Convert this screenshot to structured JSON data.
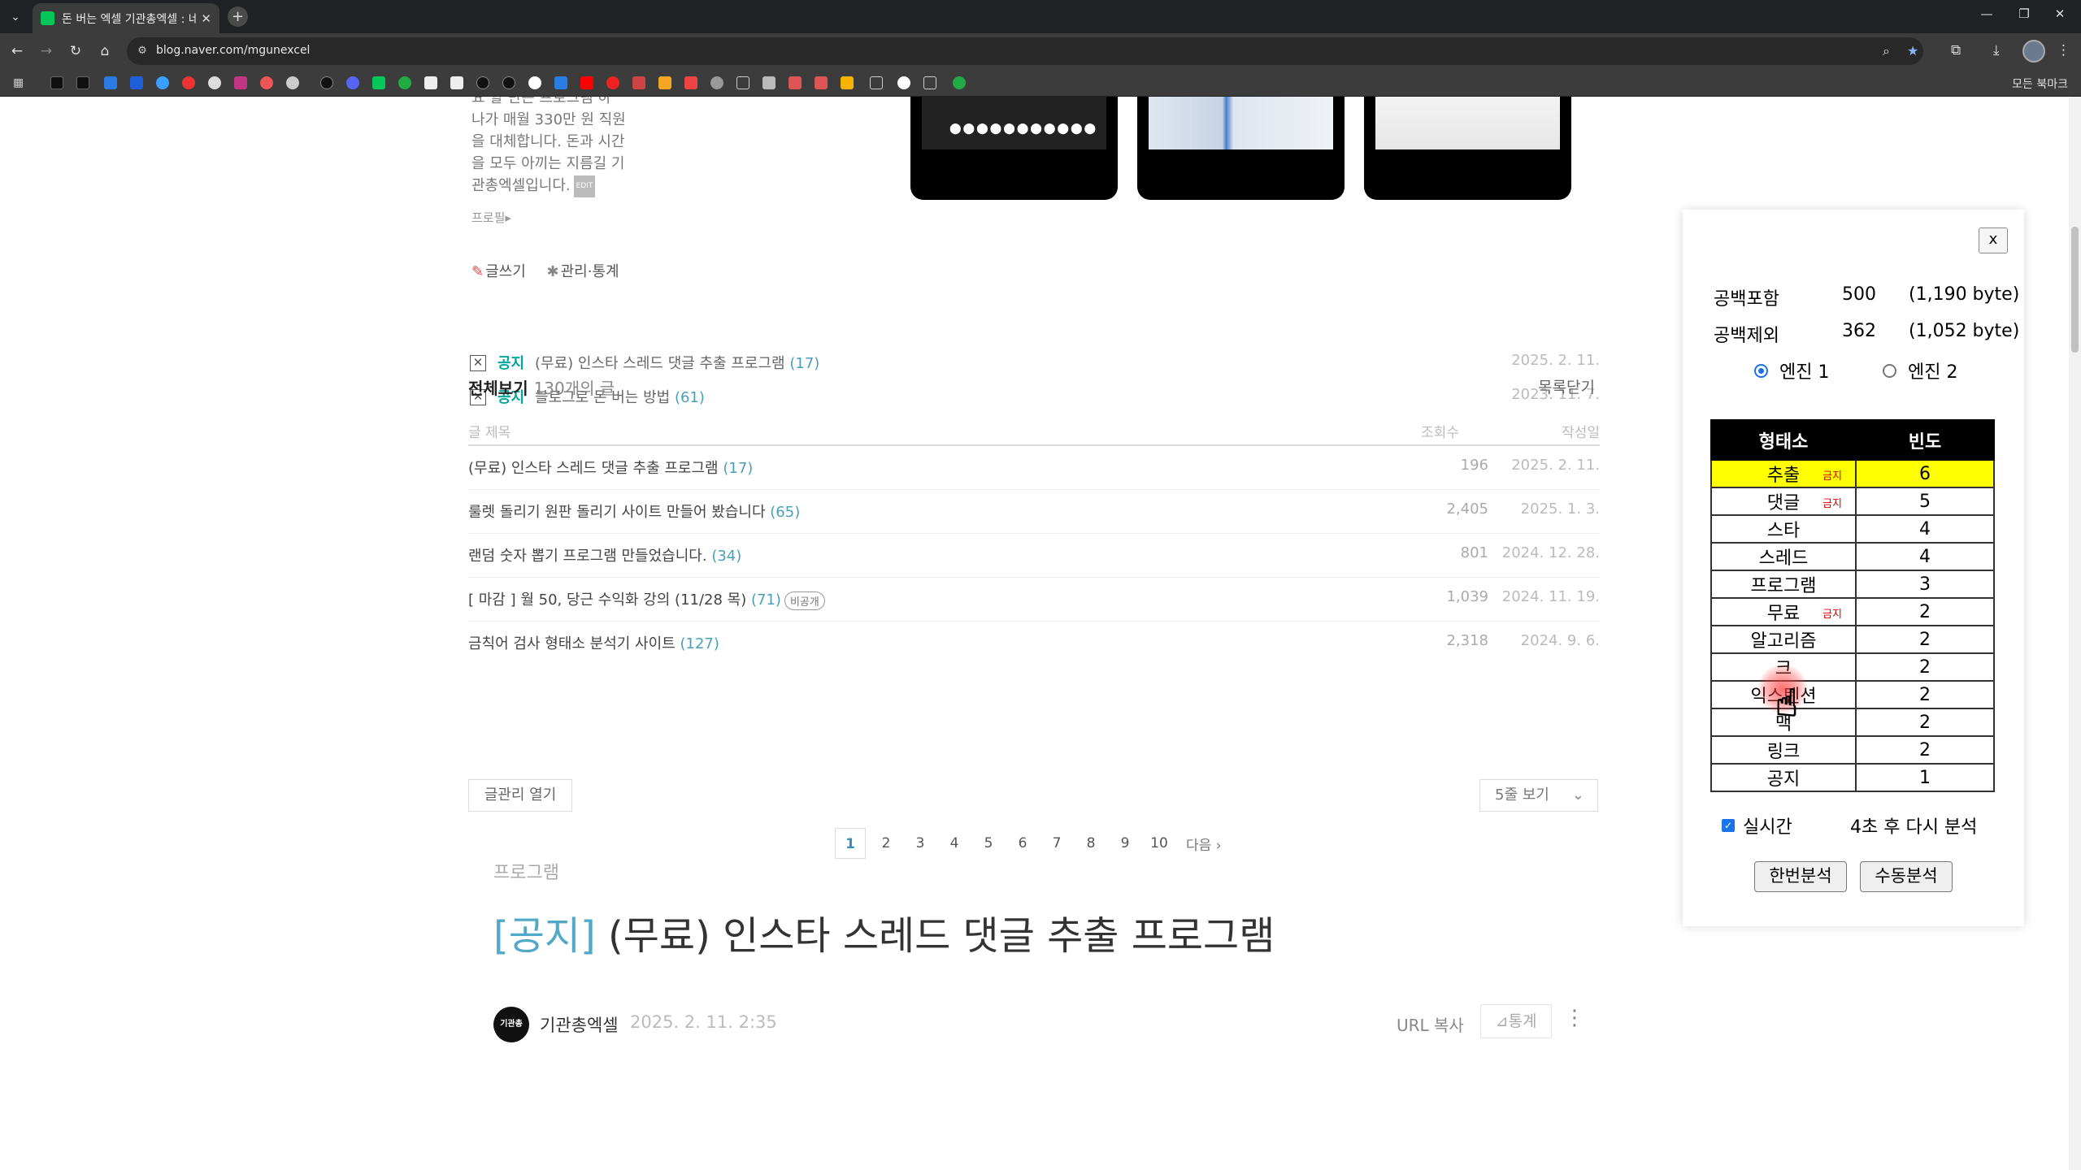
{
  "browser": {
    "tab_title": "돈 버는 엑셀 기관총엑셀 : 네이",
    "url": "blog.naver.com/mgunexcel",
    "all_bookmarks": "모든 북마크"
  },
  "profile": {
    "desc_lines": [
      "요  할 만든 프로그램 하",
      "나가 매월 330만 원 직원",
      "을 대체합니다.   돈과 시간",
      "을 모두 아끼는 지름길 기",
      "관총엑셀입니다."
    ],
    "edit_badge": "EDIT",
    "profile_link": "프로필▸",
    "write": "글쓰기",
    "manage": "관리·통계"
  },
  "notices": [
    {
      "tag": "공지",
      "title": "(무료) 인스타 스레드 댓글 추출 프로그램",
      "count": "(17)",
      "date": "2025. 2. 11."
    },
    {
      "tag": "공지",
      "title": "블로그로 돈 버는 방법",
      "count": "(61)",
      "date": "2023. 11. 7."
    }
  ],
  "post_list": {
    "heading": "전체보기",
    "total": "130개의 글",
    "close": "목록닫기",
    "col_title": "글 제목",
    "col_views": "조회수",
    "col_date": "작성일",
    "rows": [
      {
        "title": "(무료) 인스타 스레드 댓글 추출 프로그램",
        "count": "(17)",
        "views": "196",
        "date": "2025. 2. 11."
      },
      {
        "title": "룰렛 돌리기 원판 돌리기 사이트 만들어 봤습니다",
        "count": "(65)",
        "views": "2,405",
        "date": "2025. 1. 3."
      },
      {
        "title": "랜덤 숫자 뽑기 프로그램 만들었습니다.",
        "count": "(34)",
        "views": "801",
        "date": "2024. 12. 28."
      },
      {
        "title": "[ 마감 ] 월 50, 당근 수익화 강의 (11/28 목)",
        "count": "(71)",
        "badge": "비공개",
        "views": "1,039",
        "date": "2024. 11. 19."
      },
      {
        "title": "금칙어 검사 형태소 분석기 사이트",
        "count": "(127)",
        "views": "2,318",
        "date": "2024. 9. 6."
      }
    ],
    "manage_btn": "글관리 열기",
    "rows_select": "5줄 보기",
    "pages": [
      "1",
      "2",
      "3",
      "4",
      "5",
      "6",
      "7",
      "8",
      "9",
      "10"
    ],
    "next": "다음"
  },
  "post": {
    "category": "프로그램",
    "bracket": "[공지]",
    "title": "(무료) 인스타 스레드 댓글 추출 프로그램",
    "author": "기관총엑셀",
    "avatar_text": "기관총",
    "date": "2025. 2. 11. 2:35",
    "url_copy": "URL 복사",
    "stats": "통계"
  },
  "analyzer": {
    "close": "x",
    "with_space_label": "공백포함",
    "with_space_count": "500",
    "with_space_bytes": "(1,190 byte)",
    "no_space_label": "공백제외",
    "no_space_count": "362",
    "no_space_bytes": "(1,052 byte)",
    "engine1": "엔진 1",
    "engine2": "엔진 2",
    "col_morpheme": "형태소",
    "col_freq": "빈도",
    "rows": [
      {
        "word": "추출",
        "ban": "금지",
        "freq": "6"
      },
      {
        "word": "댓글",
        "ban": "금지",
        "freq": "5"
      },
      {
        "word": "스타",
        "ban": "",
        "freq": "4"
      },
      {
        "word": "스레드",
        "ban": "",
        "freq": "4"
      },
      {
        "word": "프로그램",
        "ban": "",
        "freq": "3"
      },
      {
        "word": "무료",
        "ban": "금지",
        "freq": "2"
      },
      {
        "word": "알고리즘",
        "ban": "",
        "freq": "2"
      },
      {
        "word": "크",
        "ban": "",
        "freq": "2"
      },
      {
        "word": "익스텐션",
        "ban": "",
        "freq": "2"
      },
      {
        "word": "맥",
        "ban": "",
        "freq": "2"
      },
      {
        "word": "링크",
        "ban": "",
        "freq": "2"
      },
      {
        "word": "공지",
        "ban": "",
        "freq": "1"
      }
    ],
    "realtime": "실시간",
    "countdown": "4초 후 다시 분석",
    "btn_once": "한번분석",
    "btn_manual": "수동분석"
  }
}
